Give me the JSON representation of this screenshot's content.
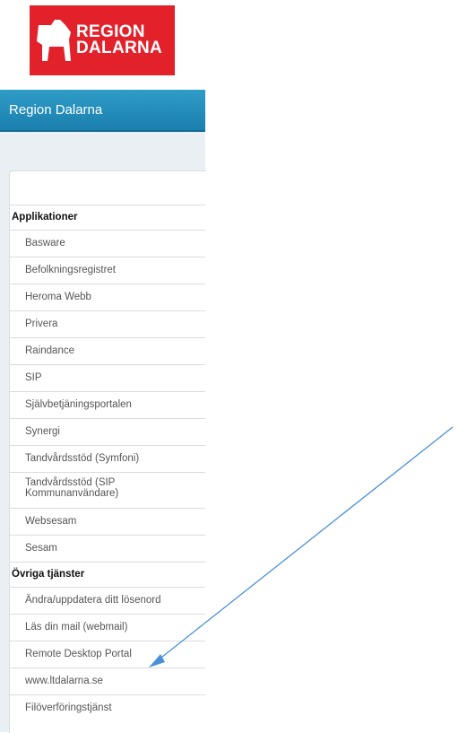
{
  "logo": {
    "line1": "REGION",
    "line2": "DALARNA",
    "color": "#e3212b"
  },
  "header": {
    "title": "Region Dalarna"
  },
  "sections": [
    {
      "title": "Applikationer",
      "items": [
        "Basware",
        "Befolkningsregistret",
        "Heroma Webb",
        "Privera",
        "Raindance",
        "SIP",
        "Självbetjäningsportalen",
        "Synergi",
        "Tandvårdsstöd (Symfoni)",
        "Tandvårdsstöd (SIP Kommunanvändare)",
        "Websesam",
        "Sesam"
      ]
    },
    {
      "title": "Övriga tjänster",
      "items": [
        "Ändra/uppdatera ditt lösenord",
        "Läs din mail (webmail)",
        "Remote Desktop Portal",
        "www.ltdalarna.se",
        "Filöverföringstjänst"
      ]
    }
  ],
  "annotation": {
    "color": "#4a90d9",
    "target": "Remote Desktop Portal"
  }
}
